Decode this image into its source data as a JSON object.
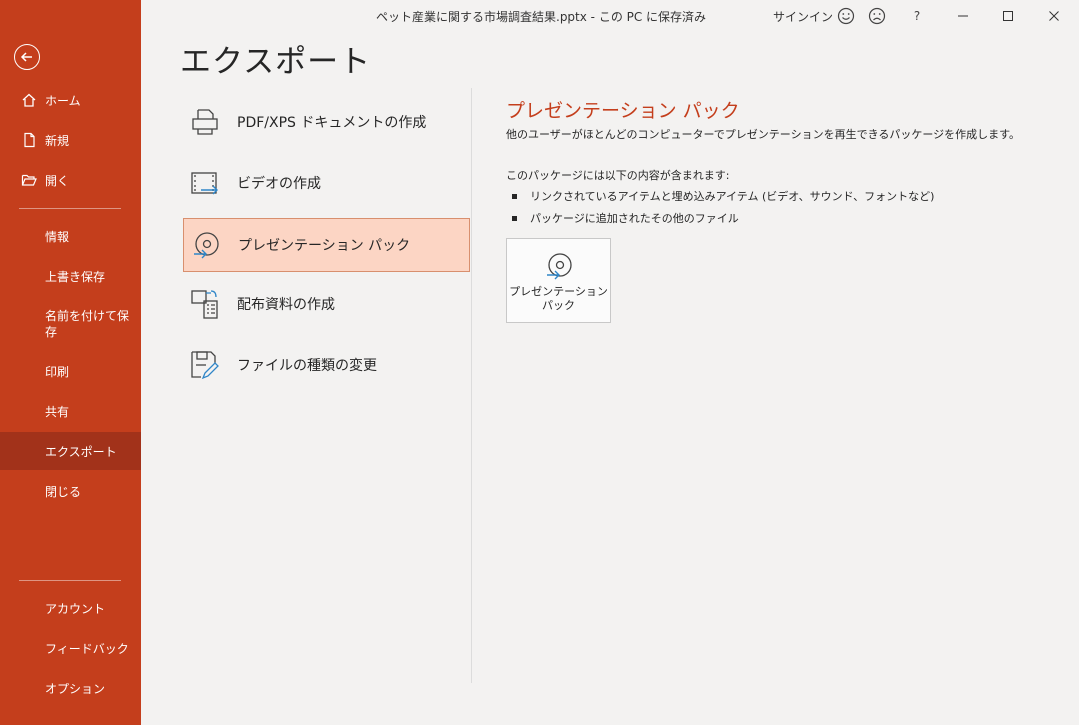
{
  "window": {
    "doc_title": "ペット産業に関する市場調査結果.pptx  -  この PC に保存済み",
    "signin": "サインイン",
    "help": "?"
  },
  "sidebar": {
    "top_items": [
      {
        "label": "ホーム",
        "icon": "home-icon"
      },
      {
        "label": "新規",
        "icon": "new-document-icon"
      },
      {
        "label": "開く",
        "icon": "folder-open-icon"
      }
    ],
    "middle_items": [
      "情報",
      "上書き保存",
      "名前を付けて保存",
      "印刷",
      "共有",
      "エクスポート",
      "閉じる"
    ],
    "selected": "エクスポート",
    "bottom_items": [
      "アカウント",
      "フィードバック",
      "オプション"
    ]
  },
  "main": {
    "title": "エクスポート",
    "options": [
      {
        "label": "PDF/XPS ドキュメントの作成",
        "icon": "pdf-xps-icon"
      },
      {
        "label": "ビデオの作成",
        "icon": "video-icon"
      },
      {
        "label": "プレゼンテーション パック",
        "icon": "cd-package-icon"
      },
      {
        "label": "配布資料の作成",
        "icon": "handout-icon"
      },
      {
        "label": "ファイルの種類の変更",
        "icon": "change-file-type-icon"
      }
    ],
    "selected_option": "プレゼンテーション パック"
  },
  "detail": {
    "title": "プレゼンテーション パック",
    "description": "他のユーザーがほとんどのコンピューターでプレゼンテーションを再生できるパッケージを作成します。",
    "includes_heading": "このパッケージには以下の内容が含まれます:",
    "bullets": [
      "リンクされているアイテムと埋め込みアイテム (ビデオ、サウンド、フォントなど)",
      "パッケージに追加されたその他のファイル"
    ],
    "button_label": "プレゼンテーション パック"
  },
  "colors": {
    "accent": "#c43e1c",
    "sidebar_selected": "#a2321a",
    "option_selected_bg": "#fcd5c4",
    "option_selected_border": "#d88f6e"
  }
}
